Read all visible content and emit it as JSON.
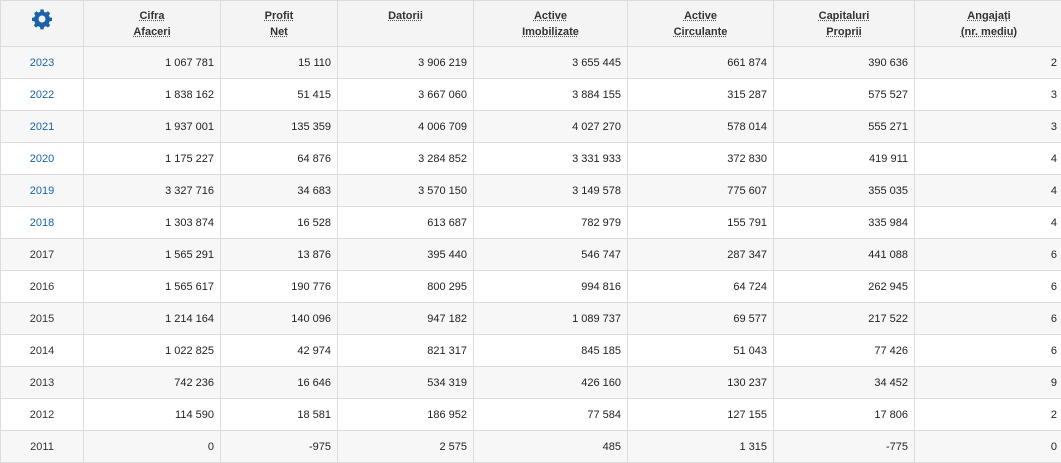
{
  "header": {
    "settings_icon": "gear-icon",
    "columns": [
      {
        "line1": "Cifra",
        "line2": "Afaceri"
      },
      {
        "line1": "Profit",
        "line2": "Net"
      },
      {
        "line1": "Datorii",
        "line2": ""
      },
      {
        "line1": "Active",
        "line2": "Imobilizate"
      },
      {
        "line1": "Active",
        "line2": "Circulante"
      },
      {
        "line1": "Capitaluri",
        "line2": "Proprii"
      },
      {
        "line1": "Angajați",
        "line2": "(nr. mediu)"
      }
    ]
  },
  "rows": [
    {
      "year": "2023",
      "linked": true,
      "values": [
        "1 067 781",
        "15 110",
        "3 906 219",
        "3 655 445",
        "661 874",
        "390 636",
        "2"
      ]
    },
    {
      "year": "2022",
      "linked": true,
      "values": [
        "1 838 162",
        "51 415",
        "3 667 060",
        "3 884 155",
        "315 287",
        "575 527",
        "3"
      ]
    },
    {
      "year": "2021",
      "linked": true,
      "values": [
        "1 937 001",
        "135 359",
        "4 006 709",
        "4 027 270",
        "578 014",
        "555 271",
        "3"
      ]
    },
    {
      "year": "2020",
      "linked": true,
      "values": [
        "1 175 227",
        "64 876",
        "3 284 852",
        "3 331 933",
        "372 830",
        "419 911",
        "4"
      ]
    },
    {
      "year": "2019",
      "linked": true,
      "values": [
        "3 327 716",
        "34 683",
        "3 570 150",
        "3 149 578",
        "775 607",
        "355 035",
        "4"
      ]
    },
    {
      "year": "2018",
      "linked": true,
      "values": [
        "1 303 874",
        "16 528",
        "613 687",
        "782 979",
        "155 791",
        "335 984",
        "4"
      ]
    },
    {
      "year": "2017",
      "linked": false,
      "values": [
        "1 565 291",
        "13 876",
        "395 440",
        "546 747",
        "287 347",
        "441 088",
        "6"
      ]
    },
    {
      "year": "2016",
      "linked": false,
      "values": [
        "1 565 617",
        "190 776",
        "800 295",
        "994 816",
        "64 724",
        "262 945",
        "6"
      ]
    },
    {
      "year": "2015",
      "linked": false,
      "values": [
        "1 214 164",
        "140 096",
        "947 182",
        "1 089 737",
        "69 577",
        "217 522",
        "6"
      ]
    },
    {
      "year": "2014",
      "linked": false,
      "values": [
        "1 022 825",
        "42 974",
        "821 317",
        "845 185",
        "51 043",
        "77 426",
        "6"
      ]
    },
    {
      "year": "2013",
      "linked": false,
      "values": [
        "742 236",
        "16 646",
        "534 319",
        "426 160",
        "130 237",
        "34 452",
        "9"
      ]
    },
    {
      "year": "2012",
      "linked": false,
      "values": [
        "114 590",
        "18 581",
        "186 952",
        "77 584",
        "127 155",
        "17 806",
        "2"
      ]
    },
    {
      "year": "2011",
      "linked": false,
      "values": [
        "0",
        "-975",
        "2 575",
        "485",
        "1 315",
        "-775",
        "0"
      ]
    }
  ],
  "colors": {
    "link": "#1a63a8",
    "gear": "#1a63a8",
    "header_bg": "#f4f4f4",
    "row_alt_bg": "#f7f7f7",
    "border": "#dcdcdc"
  }
}
